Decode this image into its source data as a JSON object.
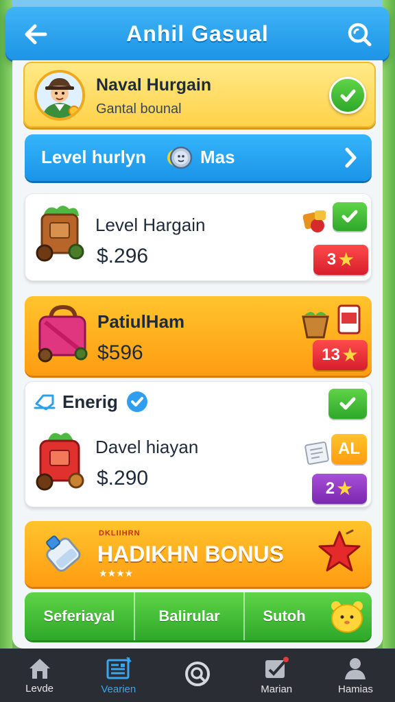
{
  "header": {
    "title": "Anhil Gasual"
  },
  "profile": {
    "name": "Naval Hurgain",
    "subtitle": "Gantal bounal"
  },
  "level_bar": {
    "label": "Level hurlyn",
    "suffix": "Mas"
  },
  "items": [
    {
      "title": "Level Hargain",
      "price": "$.296",
      "badge_value": "3"
    },
    {
      "title": "PatiulHam",
      "price": "$596",
      "badge_value": "13"
    },
    {
      "section_title": "Enerig",
      "title": "Davel hiayan",
      "price": "$.290",
      "badge_tag": "AL",
      "badge_value": "2"
    }
  ],
  "bonus": {
    "small_label": "DKLIIHRN",
    "title": "HADIKHN BONUS",
    "stars": "★★★★"
  },
  "segments": [
    "Seferiayal",
    "Balirular",
    "Sutoh"
  ],
  "tabbar": [
    {
      "label": "Levde",
      "icon": "home-icon",
      "active": false
    },
    {
      "label": "Vearien",
      "icon": "news-icon",
      "active": true
    },
    {
      "label": "",
      "icon": "search-icon",
      "active": false
    },
    {
      "label": "Marian",
      "icon": "notes-icon",
      "active": false
    },
    {
      "label": "Hamias",
      "icon": "profile-icon",
      "active": false
    }
  ],
  "colors": {
    "header_blue": "#1d94e6",
    "accent_green": "#2ea82a",
    "accent_orange": "#ff9c12",
    "accent_red": "#d61f2c",
    "accent_purple": "#7a27b0",
    "active_tab": "#39a7f0"
  }
}
